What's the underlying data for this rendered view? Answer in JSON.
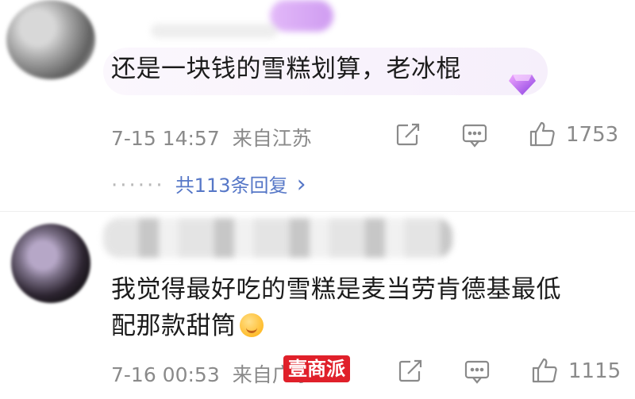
{
  "comments": [
    {
      "text": "还是一块钱的雪糕划算，老冰棍",
      "timestamp": "7-15 14:57",
      "location": "来自江苏",
      "likes": "1753",
      "replies_label": "共113条回复",
      "reply_chevron": "›",
      "dots": "······"
    },
    {
      "text_line1": "我觉得最好吃的雪糕是麦当劳肯德基最低",
      "text_line2": "配那款甜筒",
      "timestamp": "7-16 00:53",
      "location": "来自广东",
      "likes": "1115"
    }
  ],
  "watermark": "壹商派",
  "icons": {
    "share": "share-icon",
    "comment": "comment-icon",
    "like": "thumbs-up-icon",
    "badge": "gem-badge-icon",
    "emoji": "smiling-face-emoji"
  },
  "colors": {
    "meta_gray": "#8a8a8a",
    "reply_blue": "#5677c7",
    "badge_purple": "#b36af0",
    "watermark_red": "#e0202a"
  }
}
